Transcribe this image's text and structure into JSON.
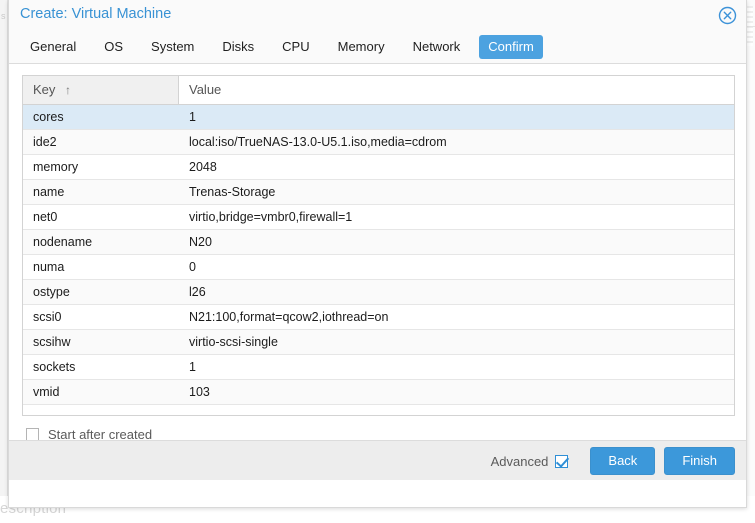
{
  "backdrop": {
    "left_edge_text": "s s",
    "bottom_text": "escription"
  },
  "dialog": {
    "title": "Create: Virtual Machine",
    "close_icon": "close-circle-icon",
    "tabs": [
      {
        "label": "General",
        "active": false
      },
      {
        "label": "OS",
        "active": false
      },
      {
        "label": "System",
        "active": false
      },
      {
        "label": "Disks",
        "active": false
      },
      {
        "label": "CPU",
        "active": false
      },
      {
        "label": "Memory",
        "active": false
      },
      {
        "label": "Network",
        "active": false
      },
      {
        "label": "Confirm",
        "active": true
      }
    ],
    "grid": {
      "columns": [
        {
          "label": "Key",
          "sort_arrow": "↑",
          "sorted": true
        },
        {
          "label": "Value",
          "sort_arrow": "",
          "sorted": false
        }
      ],
      "rows": [
        {
          "key": "cores",
          "value": "1",
          "selected": true
        },
        {
          "key": "ide2",
          "value": "local:iso/TrueNAS-13.0-U5.1.iso,media=cdrom",
          "selected": false
        },
        {
          "key": "memory",
          "value": "2048",
          "selected": false
        },
        {
          "key": "name",
          "value": "Trenas-Storage",
          "selected": false
        },
        {
          "key": "net0",
          "value": "virtio,bridge=vmbr0,firewall=1",
          "selected": false
        },
        {
          "key": "nodename",
          "value": "N20",
          "selected": false
        },
        {
          "key": "numa",
          "value": "0",
          "selected": false
        },
        {
          "key": "ostype",
          "value": "l26",
          "selected": false
        },
        {
          "key": "scsi0",
          "value": "N21:100,format=qcow2,iothread=on",
          "selected": false
        },
        {
          "key": "scsihw",
          "value": "virtio-scsi-single",
          "selected": false
        },
        {
          "key": "sockets",
          "value": "1",
          "selected": false
        },
        {
          "key": "vmid",
          "value": "103",
          "selected": false
        }
      ]
    },
    "start_after_created": {
      "label": "Start after created",
      "checked": false
    },
    "footer": {
      "advanced_label": "Advanced",
      "advanced_checked": true,
      "back_label": "Back",
      "finish_label": "Finish"
    }
  },
  "colors": {
    "accent_blue": "#3c98da",
    "title_blue": "#3892d4",
    "active_tab_blue": "#4ca2e0",
    "row_selected": "#dbeaf6",
    "row_alt": "#fafafa",
    "footer_bg": "#ededed",
    "grid_border": "#d3d3d3"
  }
}
